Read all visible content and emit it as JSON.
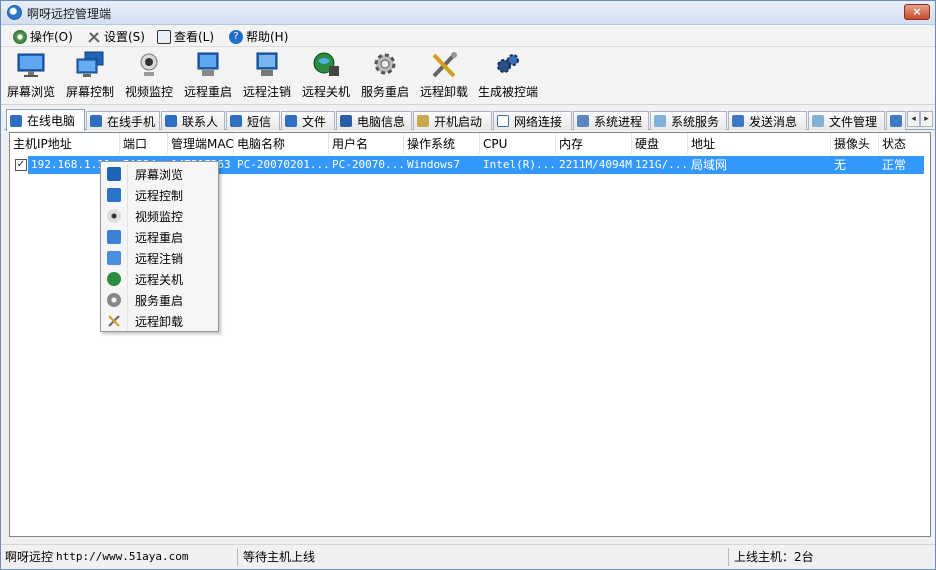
{
  "window": {
    "title": "啊呀远控管理端",
    "close_glyph": "×"
  },
  "menu": [
    {
      "label": "操作(O)",
      "icon": "gear-icon"
    },
    {
      "label": "设置(S)",
      "icon": "tools-icon"
    },
    {
      "label": "查看(L)",
      "icon": "view-icon"
    },
    {
      "label": "帮助(H)",
      "icon": "help-icon"
    }
  ],
  "toolbar": [
    {
      "label": "屏幕浏览",
      "icon": "monitor-icon"
    },
    {
      "label": "屏幕控制",
      "icon": "screens-icon"
    },
    {
      "label": "视频监控",
      "icon": "webcam-icon"
    },
    {
      "label": "远程重启",
      "icon": "restart-icon"
    },
    {
      "label": "远程注销",
      "icon": "logoff-icon"
    },
    {
      "label": "远程关机",
      "icon": "shutdown-icon"
    },
    {
      "label": "服务重启",
      "icon": "service-gear-icon"
    },
    {
      "label": "远程卸载",
      "icon": "uninstall-tools-icon"
    },
    {
      "label": "生成被控端",
      "icon": "generate-gears-icon"
    }
  ],
  "tabs": [
    {
      "label": "在线电脑",
      "icon": "computer-icon",
      "active": true
    },
    {
      "label": "在线手机",
      "icon": "phone-icon"
    },
    {
      "label": "联系人",
      "icon": "contacts-icon"
    },
    {
      "label": "短信",
      "icon": "sms-icon"
    },
    {
      "label": "文件",
      "icon": "file-icon"
    },
    {
      "label": "电脑信息",
      "icon": "info-icon"
    },
    {
      "label": "开机启动",
      "icon": "folder-icon"
    },
    {
      "label": "网络连接",
      "icon": "network-icon"
    },
    {
      "label": "系统进程",
      "icon": "process-icon"
    },
    {
      "label": "系统服务",
      "icon": "services-icon"
    },
    {
      "label": "发送消息",
      "icon": "message-icon"
    },
    {
      "label": "文件管理",
      "icon": "file-manager-icon"
    }
  ],
  "table": {
    "columns": [
      "主机IP地址",
      "端口",
      "管理端MAC",
      "电脑名称",
      "用户名",
      "操作系统",
      "CPU",
      "内存",
      "硬盘",
      "地址",
      "摄像头",
      "状态"
    ],
    "rows": [
      {
        "checked": true,
        "cells": [
          "192.168.1.11",
          "5A524",
          "14751F263",
          "PC-20070201...",
          "PC-20070...",
          "Windows7",
          "Intel(R)...",
          "2211M/4094M",
          "121G/...",
          "局域网",
          "无",
          "正常"
        ]
      }
    ]
  },
  "context_menu": [
    {
      "label": "屏幕浏览",
      "icon": "monitor-icon"
    },
    {
      "label": "远程控制",
      "icon": "screens-icon"
    },
    {
      "label": "视频监控",
      "icon": "webcam-icon"
    },
    {
      "label": "远程重启",
      "icon": "restart-icon"
    },
    {
      "label": "远程注销",
      "icon": "logoff-icon"
    },
    {
      "label": "远程关机",
      "icon": "shutdown-icon"
    },
    {
      "label": "服务重启",
      "icon": "service-gear-icon"
    },
    {
      "label": "远程卸载",
      "icon": "uninstall-tools-icon"
    }
  ],
  "status": {
    "brand": "啊呀远控",
    "url": "http://www.51aya.com",
    "message": "等待主机上线",
    "online": "上线主机：2台"
  },
  "colors": {
    "selection": "#3399ff",
    "tab_border": "#8ea3c0"
  }
}
